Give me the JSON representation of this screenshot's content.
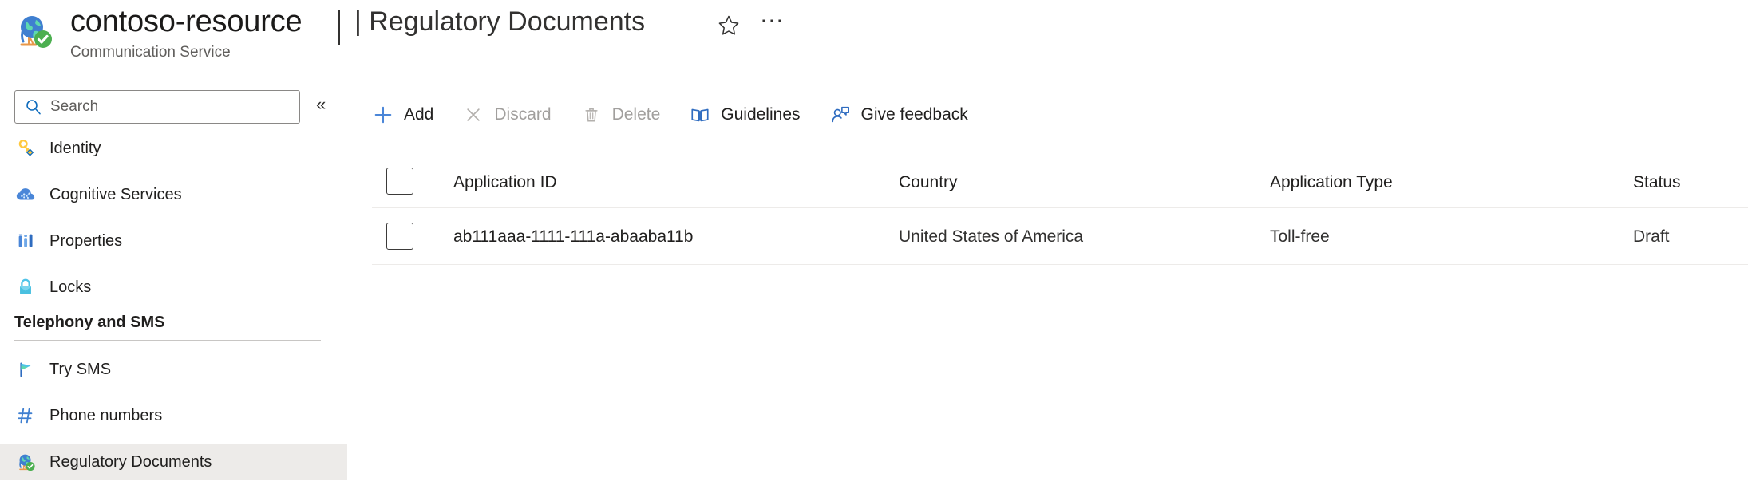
{
  "header": {
    "resource_name": "contoso-resource",
    "resource_type": "Communication Service",
    "page_name": "| Regulatory Documents",
    "favorite_icon": "star-icon",
    "more_icon": "⋯",
    "logo_icon": "globe-check-icon"
  },
  "sidebar": {
    "search": {
      "placeholder": "Search",
      "value": "",
      "icon": "search-icon"
    },
    "collapse_label": "«",
    "items": [
      {
        "label": "Identity",
        "icon": "key-icon",
        "selected": false
      },
      {
        "label": "Cognitive Services",
        "icon": "cloud-icon",
        "selected": false
      },
      {
        "label": "Properties",
        "icon": "bars-icon",
        "selected": false
      },
      {
        "label": "Locks",
        "icon": "lock-icon",
        "selected": false
      }
    ],
    "section": {
      "title": "Telephony and SMS"
    },
    "section_items": [
      {
        "label": "Try SMS",
        "icon": "flag-icon",
        "selected": false
      },
      {
        "label": "Phone numbers",
        "icon": "hash-icon",
        "selected": false
      },
      {
        "label": "Regulatory Documents",
        "icon": "globe-check-icon",
        "selected": true
      }
    ]
  },
  "toolbar": {
    "commands": [
      {
        "label": "Add",
        "icon": "plus-icon",
        "disabled": false
      },
      {
        "label": "Discard",
        "icon": "close-icon",
        "disabled": true
      },
      {
        "label": "Delete",
        "icon": "trash-icon",
        "disabled": true
      },
      {
        "label": "Guidelines",
        "icon": "book-icon",
        "disabled": false
      },
      {
        "label": "Give feedback",
        "icon": "feedback-person-icon",
        "disabled": false
      }
    ]
  },
  "table": {
    "columns": [
      "Application ID",
      "Country",
      "Application Type",
      "Status"
    ],
    "rows": [
      {
        "application_id": "ab111aaa-1111-111a-abaaba11b",
        "country": "United States of America",
        "application_type": "Toll-free",
        "status": "Draft"
      }
    ]
  },
  "colors": {
    "accent": "#0078d4",
    "icon_blue": "#4a86d8",
    "selected_bg": "#edebe9",
    "text_primary": "#201f1e",
    "text_secondary": "#605e5c",
    "disabled": "#a19f9d"
  }
}
